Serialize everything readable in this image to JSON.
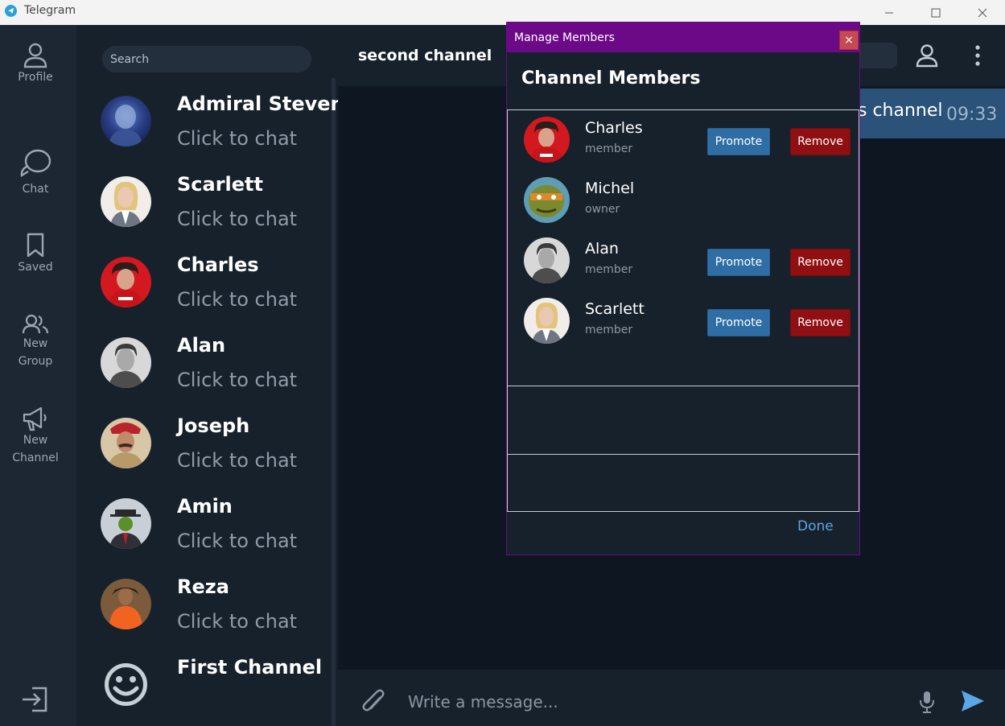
{
  "window": {
    "title": "Telegram",
    "icon": "telegram-logo-icon",
    "controls": [
      "minimize-icon",
      "maximize-icon",
      "close-icon"
    ]
  },
  "rail": {
    "items": [
      {
        "label": "Profile",
        "icon": "person-icon"
      },
      {
        "label": "Chat",
        "icon": "chat-bubbles-icon"
      },
      {
        "label": "Saved",
        "icon": "bookmark-icon"
      },
      {
        "label_line1": "New",
        "label_line2": "Group",
        "icon": "group-icon"
      },
      {
        "label_line1": "New",
        "label_line2": "Channel",
        "icon": "megaphone-icon"
      }
    ],
    "logout_icon": "logout-icon"
  },
  "chatlist": {
    "search_placeholder": "Search",
    "items": [
      {
        "name": "Admiral Steven",
        "sub": "Click to chat"
      },
      {
        "name": "Scarlett",
        "sub": "Click to chat"
      },
      {
        "name": "Charles",
        "sub": "Click to chat"
      },
      {
        "name": "Alan",
        "sub": "Click to chat"
      },
      {
        "name": "Joseph",
        "sub": "Click to chat"
      },
      {
        "name": "Amin",
        "sub": "Click to chat"
      },
      {
        "name": "Reza",
        "sub": "Click to chat"
      },
      {
        "name": "First Channel",
        "sub": ""
      }
    ]
  },
  "main": {
    "channel_title": "second channel",
    "message": {
      "text": "s channel",
      "time": "09:33"
    },
    "composer_placeholder": "Write a message..."
  },
  "modal": {
    "title": "Manage Members",
    "close_label": "×",
    "heading": "Channel Members",
    "members": [
      {
        "name": "Charles",
        "role": "member",
        "promote": "Promote",
        "remove": "Remove"
      },
      {
        "name": "Michel",
        "role": "owner"
      },
      {
        "name": "Alan",
        "role": "member",
        "promote": "Promote",
        "remove": "Remove"
      },
      {
        "name": "Scarlett",
        "role": "member",
        "promote": "Promote",
        "remove": "Remove"
      }
    ],
    "done_label": "Done"
  },
  "colors": {
    "app_bg": "#17212b",
    "rail_bg": "#1c2733",
    "main_bg": "#0e1621",
    "modal_header": "#6b0987",
    "promote": "#2f6ea5",
    "remove": "#8f0f12",
    "accent": "#5aa6e6",
    "bubble": "#2b5278"
  }
}
